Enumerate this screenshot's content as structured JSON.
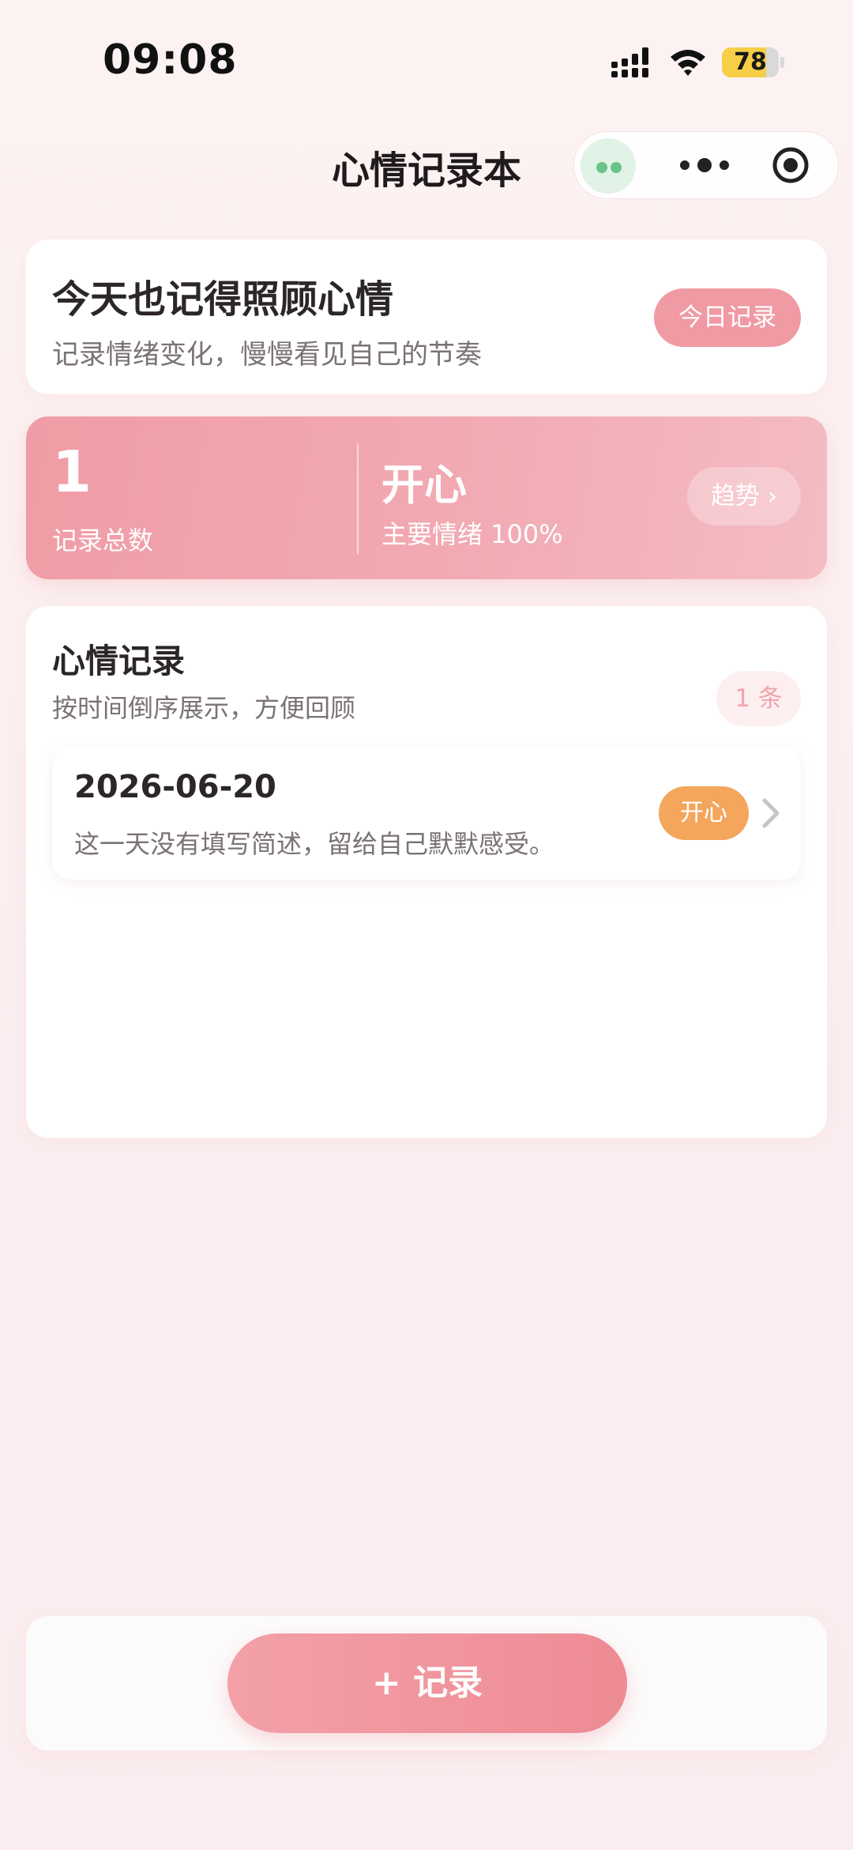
{
  "status_bar": {
    "time": "09:08",
    "battery_level": "78",
    "battery_fraction": 0.78
  },
  "nav": {
    "title": "心情记录本"
  },
  "hero": {
    "title": "今天也记得照顾心情",
    "subtitle": "记录情绪变化，慢慢看见自己的节奏",
    "today_button": "今日记录"
  },
  "stats": {
    "total_count": "1",
    "total_label": "记录总数",
    "main_mood": "开心",
    "main_mood_label": "主要情绪 100%",
    "trend_button": "趋势 ›"
  },
  "records": {
    "title": "心情记录",
    "subtitle": "按时间倒序展示，方便回顾",
    "count_badge": "1 条",
    "items": [
      {
        "date": "2026-06-20",
        "description": "这一天没有填写简述，留给自己默默感受。",
        "mood": "开心",
        "mood_color": "#f3a65c"
      }
    ]
  },
  "bottom": {
    "add_button": "+ 记录"
  },
  "colors": {
    "accent": "#f09aa3",
    "accent_dark": "#ee8b95",
    "background": "#fdf2f2"
  }
}
